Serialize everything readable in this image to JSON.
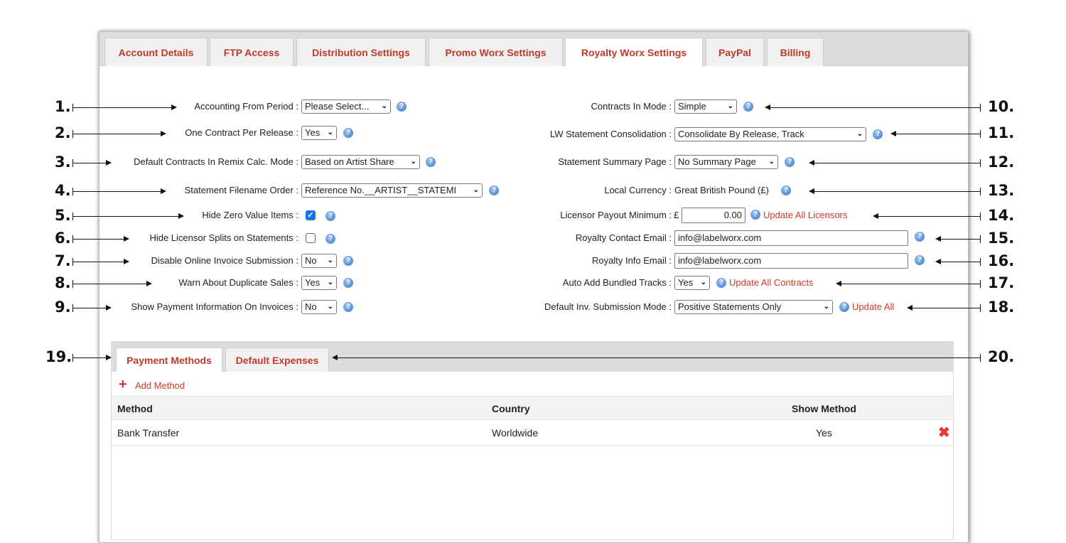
{
  "tabs": [
    "Account Details",
    "FTP Access",
    "Distribution Settings",
    "Promo Worx Settings",
    "Royalty Worx Settings",
    "PayPal",
    "Billing"
  ],
  "active_tab": "Royalty Worx Settings",
  "left": {
    "accounting_from_period": {
      "label": "Accounting From Period :",
      "value": "Please Select..."
    },
    "one_contract_per_release": {
      "label": "One Contract Per Release :",
      "value": "Yes"
    },
    "default_remix_mode": {
      "label": "Default Contracts In Remix Calc. Mode :",
      "value": "Based on Artist Share"
    },
    "statement_filename_order": {
      "label": "Statement Filename Order :",
      "value": "Reference No.__ARTIST__STATEMI"
    },
    "hide_zero_value_items": {
      "label": "Hide Zero Value Items :",
      "checked": true
    },
    "hide_licensor_splits": {
      "label": "Hide Licensor Splits on Statements :",
      "checked": false
    },
    "disable_online_invoice": {
      "label": "Disable Online Invoice Submission :",
      "value": "No"
    },
    "warn_duplicate_sales": {
      "label": "Warn About Duplicate Sales :",
      "value": "Yes"
    },
    "show_payment_info": {
      "label": "Show Payment Information On Invoices :",
      "value": "No"
    }
  },
  "right": {
    "contracts_in_mode": {
      "label": "Contracts In Mode :",
      "value": "Simple"
    },
    "lw_statement_consolidation": {
      "label": "LW Statement Consolidation :",
      "value": "Consolidate By Release, Track"
    },
    "statement_summary_page": {
      "label": "Statement Summary Page :",
      "value": "No Summary Page"
    },
    "local_currency": {
      "label": "Local Currency :",
      "value": "Great British Pound (£)"
    },
    "licensor_payout_minimum": {
      "label": "Licensor Payout Minimum :",
      "currency": "£",
      "value": "0.00",
      "link": "Update All Licensors"
    },
    "royalty_contact_email": {
      "label": "Royalty Contact Email :",
      "value": "info@labelworx.com"
    },
    "royalty_info_email": {
      "label": "Royalty Info Email :",
      "value": "info@labelworx.com"
    },
    "auto_add_bundled_tracks": {
      "label": "Auto Add Bundled Tracks :",
      "value": "Yes",
      "link": "Update All Contracts"
    },
    "default_inv_submission_mode": {
      "label": "Default Inv. Submission Mode :",
      "value": "Positive Statements Only",
      "link": "Update All"
    }
  },
  "subtabs": [
    "Payment Methods",
    "Default Expenses"
  ],
  "add_method_label": "Add Method",
  "table": {
    "headers": [
      "Method",
      "Country",
      "Show Method"
    ],
    "rows": [
      {
        "method": "Bank Transfer",
        "country": "Worldwide",
        "show": "Yes"
      }
    ]
  },
  "annotations": [
    "1.",
    "2.",
    "3.",
    "4.",
    "5.",
    "6.",
    "7.",
    "8.",
    "9.",
    "10.",
    "11.",
    "12.",
    "13.",
    "14.",
    "15.",
    "16.",
    "17.",
    "18.",
    "19.",
    "20."
  ],
  "colors": {
    "accent": "#c0392b",
    "help_icon": "#3b78c4",
    "checkbox": "#1a73e8"
  },
  "icons": {
    "help": "help-icon",
    "dropdown": "chevron-down-icon",
    "add": "plus-icon",
    "delete": "close-icon"
  }
}
